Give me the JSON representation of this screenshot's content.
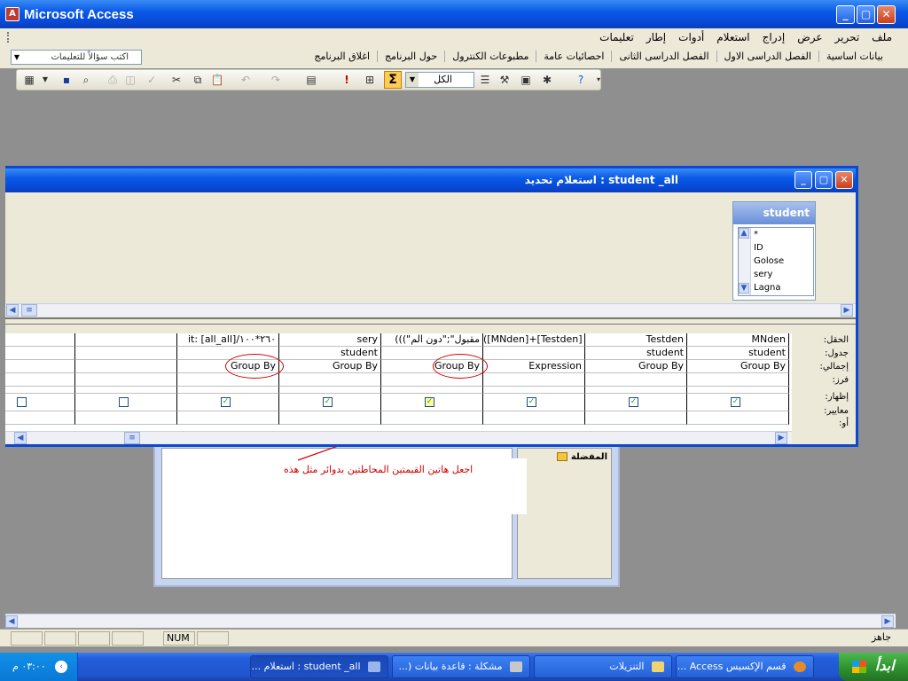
{
  "app": {
    "title": "Microsoft Access"
  },
  "menubar": {
    "items": [
      "ملف",
      "تحرير",
      "عرض",
      "إدراج",
      "استعلام",
      "أدوات",
      "إطار",
      "تعليمات"
    ]
  },
  "row2": {
    "links": [
      "بيانات اساسية",
      "الفصل الدراسى الاول",
      "الفصل الدراسى الثانى",
      "احصائيات عامة",
      "مطبوعات الكنترول",
      "حول البرنامج",
      "اغلاق البرنامج"
    ],
    "ask_placeholder": "اكتب سؤالاً للتعليمات"
  },
  "toolbar": {
    "totals_symbol": "Σ",
    "top_values": "الكل"
  },
  "query_window": {
    "title": "student _all : استعلام تحديد",
    "table": {
      "name": "student",
      "fields": [
        "*",
        "ID",
        "Golose",
        "sery",
        "Lagna"
      ]
    },
    "row_labels": [
      "الحقل:",
      "جدول:",
      "إجمالي:",
      "فرز:",
      "إظهار:",
      "معايير:",
      "أو:"
    ],
    "columns": [
      {
        "field": "MNden",
        "table": "student",
        "total": "Group By",
        "show": true
      },
      {
        "field": "Testden",
        "table": "student",
        "total": "Group By",
        "show": true
      },
      {
        "field": "([MNden]+[Testden]",
        "table": "",
        "total": "Expression",
        "show": true
      },
      {
        "field": "(((\"مقبول\";\"دون الم",
        "table": "",
        "total": "Group By",
        "show": true
      },
      {
        "field": "sery",
        "table": "student",
        "total": "Group By",
        "show": true
      },
      {
        "field": "it: [all_all]/٢٦٠*١٠٠",
        "table": "",
        "total": "Group By",
        "show": true
      },
      {
        "field": "",
        "table": "",
        "total": "",
        "show": false
      },
      {
        "field": "",
        "table": "",
        "total": "",
        "show": false
      }
    ]
  },
  "annotation": {
    "text": "اجعل هاتين القيمتين المحاطتين بدوائر مثل هذه"
  },
  "back_window": {
    "favorites": "المفضلة"
  },
  "statusbar": {
    "ready": "جاهز",
    "num": "NUM"
  },
  "taskbar": {
    "start": "ابدأ",
    "clock": "٠٣:٠٠ م",
    "tasks": [
      "قسم الإكسيس Access ...",
      "التنزيلات",
      "مشكلة : قاعدة بيانات (...",
      "student _all : استعلام ..."
    ]
  }
}
